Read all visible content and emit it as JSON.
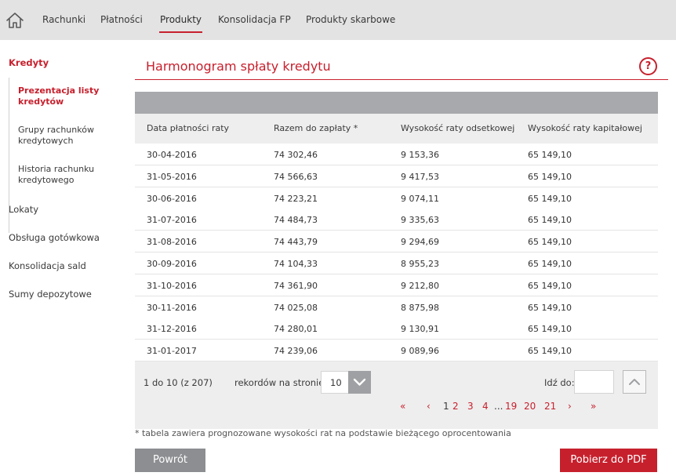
{
  "topnav": {
    "items": [
      {
        "label": "Rachunki"
      },
      {
        "label": "Płatności"
      },
      {
        "label": "Produkty"
      },
      {
        "label": "Konsolidacja FP"
      },
      {
        "label": "Produkty skarbowe"
      }
    ],
    "active_index": 2
  },
  "sidebar": {
    "header": "Kredyty",
    "subitems": [
      {
        "label": "Prezentacja listy kredytów"
      },
      {
        "label": "Grupy rachunków kredytowych"
      },
      {
        "label": "Historia rachunku kredytowego"
      }
    ],
    "items": [
      {
        "label": "Lokaty"
      },
      {
        "label": "Obsługa gotówkowa"
      },
      {
        "label": "Konsolidacja sald"
      },
      {
        "label": "Sumy depozytowe"
      }
    ]
  },
  "page": {
    "title": "Harmonogram spłaty kredytu",
    "help_label": "?"
  },
  "table": {
    "columns": [
      "Data płatności raty",
      "Razem do zapłaty *",
      "Wysokość raty odsetkowej",
      "Wysokość raty kapitałowej"
    ],
    "rows": [
      [
        "30-04-2016",
        "74 302,46",
        "9 153,36",
        "65 149,10"
      ],
      [
        "31-05-2016",
        "74 566,63",
        "9 417,53",
        "65 149,10"
      ],
      [
        "30-06-2016",
        "74 223,21",
        "9 074,11",
        "65 149,10"
      ],
      [
        "31-07-2016",
        "74 484,73",
        "9 335,63",
        "65 149,10"
      ],
      [
        "31-08-2016",
        "74 443,79",
        "9 294,69",
        "65 149,10"
      ],
      [
        "30-09-2016",
        "74 104,33",
        "8 955,23",
        "65 149,10"
      ],
      [
        "31-10-2016",
        "74 361,90",
        "9 212,80",
        "65 149,10"
      ],
      [
        "30-11-2016",
        "74 025,08",
        "8 875,98",
        "65 149,10"
      ],
      [
        "31-12-2016",
        "74 280,01",
        "9 130,91",
        "65 149,10"
      ],
      [
        "31-01-2017",
        "74 239,06",
        "9 089,96",
        "65 149,10"
      ]
    ]
  },
  "pagination": {
    "info": "1 do 10 (z 207)",
    "rpp_label": "rekordów na stronie",
    "rpp_value": "10",
    "goto_label": "Idź do:",
    "goto_value": "",
    "first": "«",
    "prev": "‹",
    "pages": [
      "1",
      "2",
      "3",
      "4",
      "...",
      "19",
      "20",
      "21"
    ],
    "current_page": "1",
    "next": "›",
    "last": "»"
  },
  "footnote": "* tabela zawiera prognozowane wysokości rat na podstawie bieżącego oprocentowania",
  "buttons": {
    "back": "Powrót",
    "pdf": "Pobierz do PDF"
  },
  "colors": {
    "accent": "#c7202d",
    "nav_bg": "#e3e3e3",
    "table_bar": "#a7a9ac",
    "header_bg": "#eeeeee",
    "back_button": "#8c8e91"
  },
  "icons": {
    "home": "home-icon",
    "help": "help-icon",
    "dropdown": "chevron-down-icon",
    "goto": "chevron-up-icon"
  }
}
